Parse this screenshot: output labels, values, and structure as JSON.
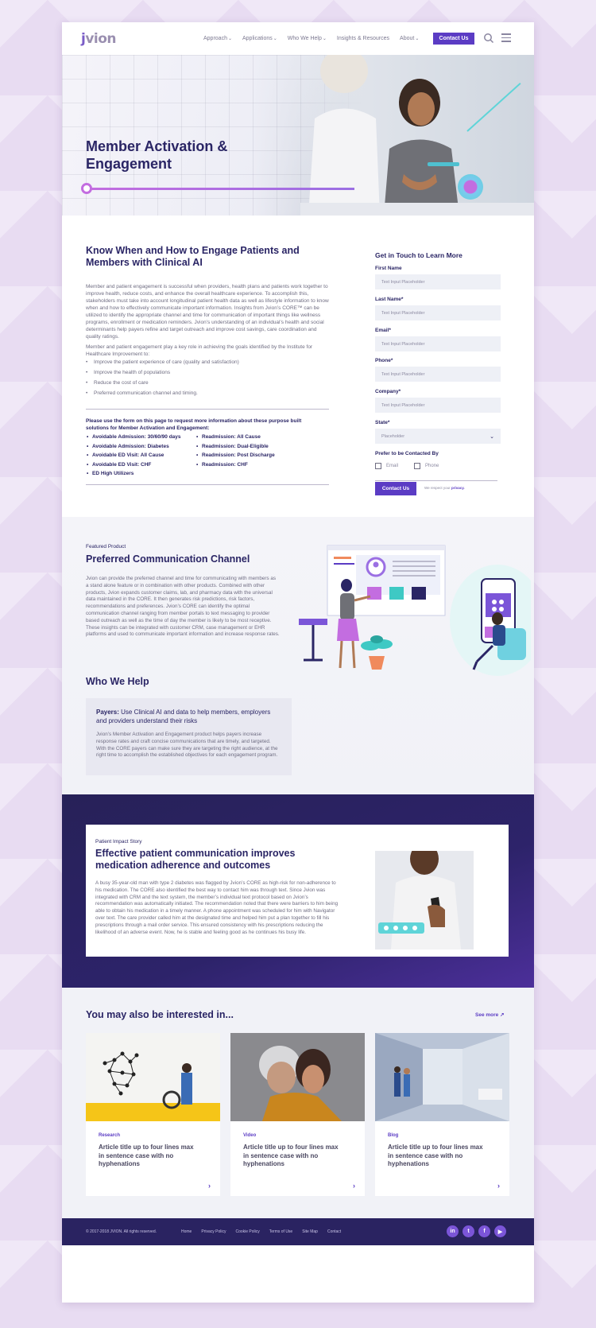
{
  "nav": {
    "logo": "jvion",
    "links": [
      "Approach",
      "Applications",
      "Who We Help",
      "Insights & Resources",
      "About"
    ],
    "cta": "Contact Us"
  },
  "hero": {
    "title": "Member Activation & Engagement"
  },
  "article": {
    "title": "Know When and How to Engage Patients and Members with Clinical AI",
    "para1": "Member and patient engagement is successful when providers, health plans and patients work together to improve health, reduce costs, and enhance the overall healthcare experience. To accomplish this, stakeholders must take into account longitudinal patient health data as well as lifestyle information to know when and how to effectively communicate important information. Insights from Jvion’s CORE™ can be utilized to identify the appropriate channel and time for communication of important things like wellness programs, enrollment or medication reminders. Jvion’s understanding of an individual’s health and social determinants help payers refine and target outreach and improve cost savings, care coordination and quality ratings.",
    "para2": "Member and patient engagement play a key role in achieving the goals identified by the Institute for Healthcare Improvement to:",
    "bullets": [
      "Improve the patient experience of care (quality and satisfaction)",
      "Improve the health of populations",
      "Reduce the cost of care",
      "Preferred communication channel and timing."
    ],
    "lead": "Please use the form on this page to request more information about these purpose built solutions for Member Activation and Engagement:",
    "tags": [
      "Avoidable Admission: 30/60/90 days",
      "Readmission: All Cause",
      "Avoidable Admission: Diabetes",
      "Readmission: Dual-Eligible",
      "Avoidable ED Visit: All Cause",
      "Readmission: Post Discharge",
      "Avoidable ED Visit: CHF",
      "Readmission: CHF",
      "ED High Utilizers"
    ]
  },
  "form": {
    "title": "Get in Touch to Learn More",
    "fields": [
      {
        "label": "First Name",
        "placeholder": "Text Input Placeholder"
      },
      {
        "label": "Last Name*",
        "placeholder": "Text Input Placeholder"
      },
      {
        "label": "Email*",
        "placeholder": "Text Input Placeholder"
      },
      {
        "label": "Phone*",
        "placeholder": "Text Input Placeholder"
      },
      {
        "label": "Company*",
        "placeholder": "Text Input Placeholder"
      }
    ],
    "state_label": "State*",
    "state_value": "Placeholder",
    "contact_label": "Prefer to be Contacted By",
    "opt_email": "Email",
    "opt_phone": "Phone",
    "submit": "Contact Us",
    "privacy_text": "We respect your",
    "privacy_link": "privacy."
  },
  "featured": {
    "eyebrow": "Featured Product",
    "title": "Preferred Communication Channel",
    "body": "Jvion can provide the preferred channel and time for communicating with members as a stand alone feature or in combination with other products. Combined with other products, Jvion expands customer claims, lab, and pharmacy data with the universal data maintained in the CORE. It then generates risk predictions, risk factors, recommendations and preferences. Jvion’s CORE can identify the optimal communication channel ranging from member portals to text messaging to provider based outreach as well as the time of day the member is likely to be most receptive. These insights can be integrated with customer CRM, case management or EHR platforms and used to communicate important information and increase response rates."
  },
  "who": {
    "title": "Who We Help",
    "card_lead": "Payers:",
    "card_title": " Use Clinical AI and data to help members, employers and providers understand their risks",
    "card_body": "Jvion’s Member Activation and Engagement product helps payers increase response rates and craft concise communications that are timely, and targeted. With the CORE payers can make sure they are targeting the right audience, at the right time to accomplish the established objectives for each engagement program."
  },
  "story": {
    "eyebrow": "Patient Impact Story",
    "title": "Effective patient communication improves medication adherence and outcomes",
    "body": "A busy 35-year-old man with type 2 diabetes was flagged by Jvion’s CORE as high-risk for non-adherence to his medication. The CORE also identified the best way to contact him was through text. Since Jvion was integrated with CRM and the text system, the member’s individual text protocol based on Jvion’s recommendation was automatically initiated. The recommendation noted that there were barriers to him being able to obtain his medication in a timely manner. A phone appointment was scheduled for him with Navigator over text. The care provider called him at the designated time and helped him put a plan together to fill his prescriptions through a mail order service. This ensured consistency with his prescriptions reducing the likelihood of an adverse event. Now, he is stable and feeling good as he continues his busy life."
  },
  "interest": {
    "title": "You may also be interested in...",
    "see_more": "See more",
    "cards": [
      {
        "category": "Research",
        "title": "Article title up to four lines max in sentence case with no hyphenations"
      },
      {
        "category": "Video",
        "title": "Article title up to four lines max in sentence case with no hyphenations"
      },
      {
        "category": "Blog",
        "title": "Article title up to four lines max in sentence case with no hyphenations"
      }
    ]
  },
  "footer": {
    "copyright": "© 2017-2018 JVION. All rights reserved.",
    "links": [
      "Home",
      "Privacy Policy",
      "Cookie Policy",
      "Terms of Use",
      "Site Map",
      "Contact"
    ],
    "socials": [
      "linkedin-icon",
      "twitter-icon",
      "facebook-icon",
      "youtube-icon"
    ]
  },
  "colors": {
    "brand": "#5b3cc4",
    "navy": "#2a2565",
    "accent": "#c36de0",
    "teal": "#5fd4d8"
  }
}
